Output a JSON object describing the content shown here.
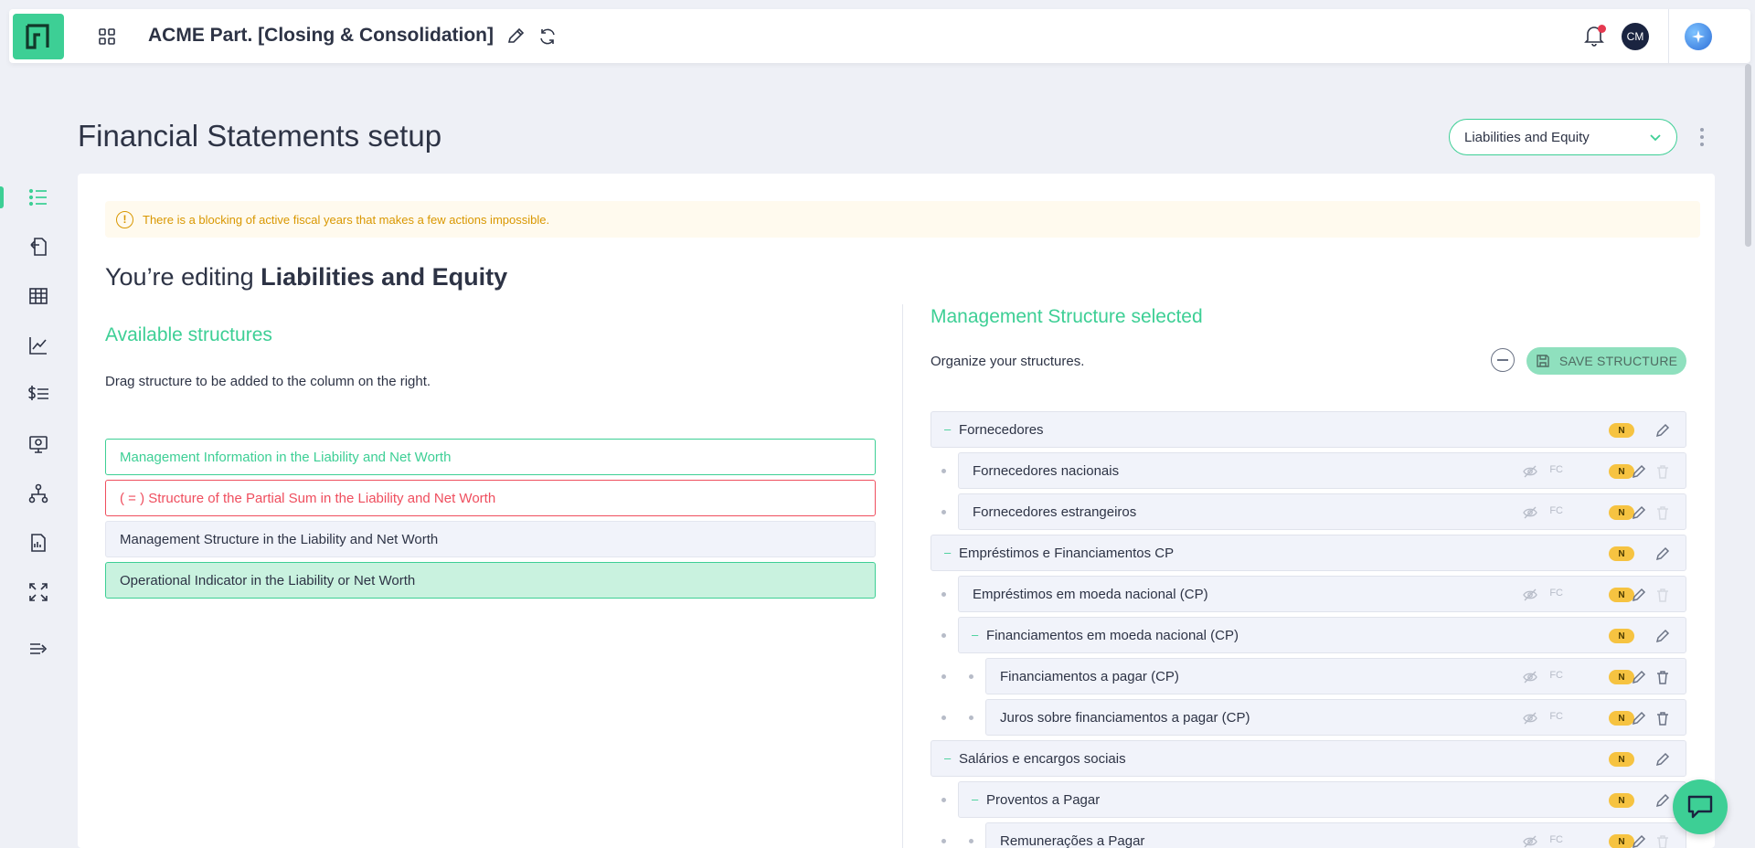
{
  "header": {
    "app_title": "ACME Part. [Closing & Consolidation]",
    "avatar_initials": "CM"
  },
  "page": {
    "title": "Financial Statements setup",
    "selector_value": "Liabilities and Equity"
  },
  "alert": {
    "text": "There is a blocking of active fiscal years that makes a few actions impossible."
  },
  "editing": {
    "prefix": "You’re editing ",
    "name": "Liabilities and Equity"
  },
  "left": {
    "title": "Available structures",
    "subtitle": "Drag structure to be added to the column on the right.",
    "items": [
      {
        "label": "Management Information in the Liability and Net Worth",
        "style": "green"
      },
      {
        "label": "( = ) Structure of the Partial Sum in the Liability and Net Worth",
        "style": "red"
      },
      {
        "label": "Management Structure in the Liability and Net Worth",
        "style": "gray"
      },
      {
        "label": "Operational Indicator in the Liability or Net Worth",
        "style": "mint"
      }
    ]
  },
  "right": {
    "title": "Management Structure selected",
    "subtitle": "Organize your structures.",
    "save_label": "SAVE STRUCTURE",
    "badge_label": "N",
    "fc_label": "FC",
    "tree": [
      {
        "label": "Fornecedores",
        "level": 0,
        "group": true
      },
      {
        "label": "Fornecedores nacionais",
        "level": 1,
        "group": false
      },
      {
        "label": "Fornecedores estrangeiros",
        "level": 1,
        "group": false
      },
      {
        "label": "Empréstimos e Financiamentos CP",
        "level": 0,
        "group": true
      },
      {
        "label": "Empréstimos em moeda nacional (CP)",
        "level": 1,
        "group": false
      },
      {
        "label": "Financiamentos em moeda nacional (CP)",
        "level": 1,
        "group": true
      },
      {
        "label": "Financiamentos a pagar (CP)",
        "level": 2,
        "group": false
      },
      {
        "label": "Juros sobre financiamentos a pagar (CP)",
        "level": 2,
        "group": false
      },
      {
        "label": "Salários e encargos sociais",
        "level": 0,
        "group": true
      },
      {
        "label": "Proventos a Pagar",
        "level": 1,
        "group": true
      },
      {
        "label": "Remunerações a Pagar",
        "level": 2,
        "group": false
      }
    ]
  },
  "sidebar": {
    "items": [
      "list-icon",
      "file-upload-icon",
      "ledger-icon",
      "chart-line-icon",
      "dollar-list-icon",
      "monitor-icon",
      "hierarchy-icon",
      "report-file-icon",
      "expand-icon",
      "collapse-menu-icon"
    ]
  },
  "colors": {
    "accent": "#3dcf95",
    "danger": "#ef4e5e",
    "warning": "#d99700",
    "badge": "#f6c341"
  }
}
